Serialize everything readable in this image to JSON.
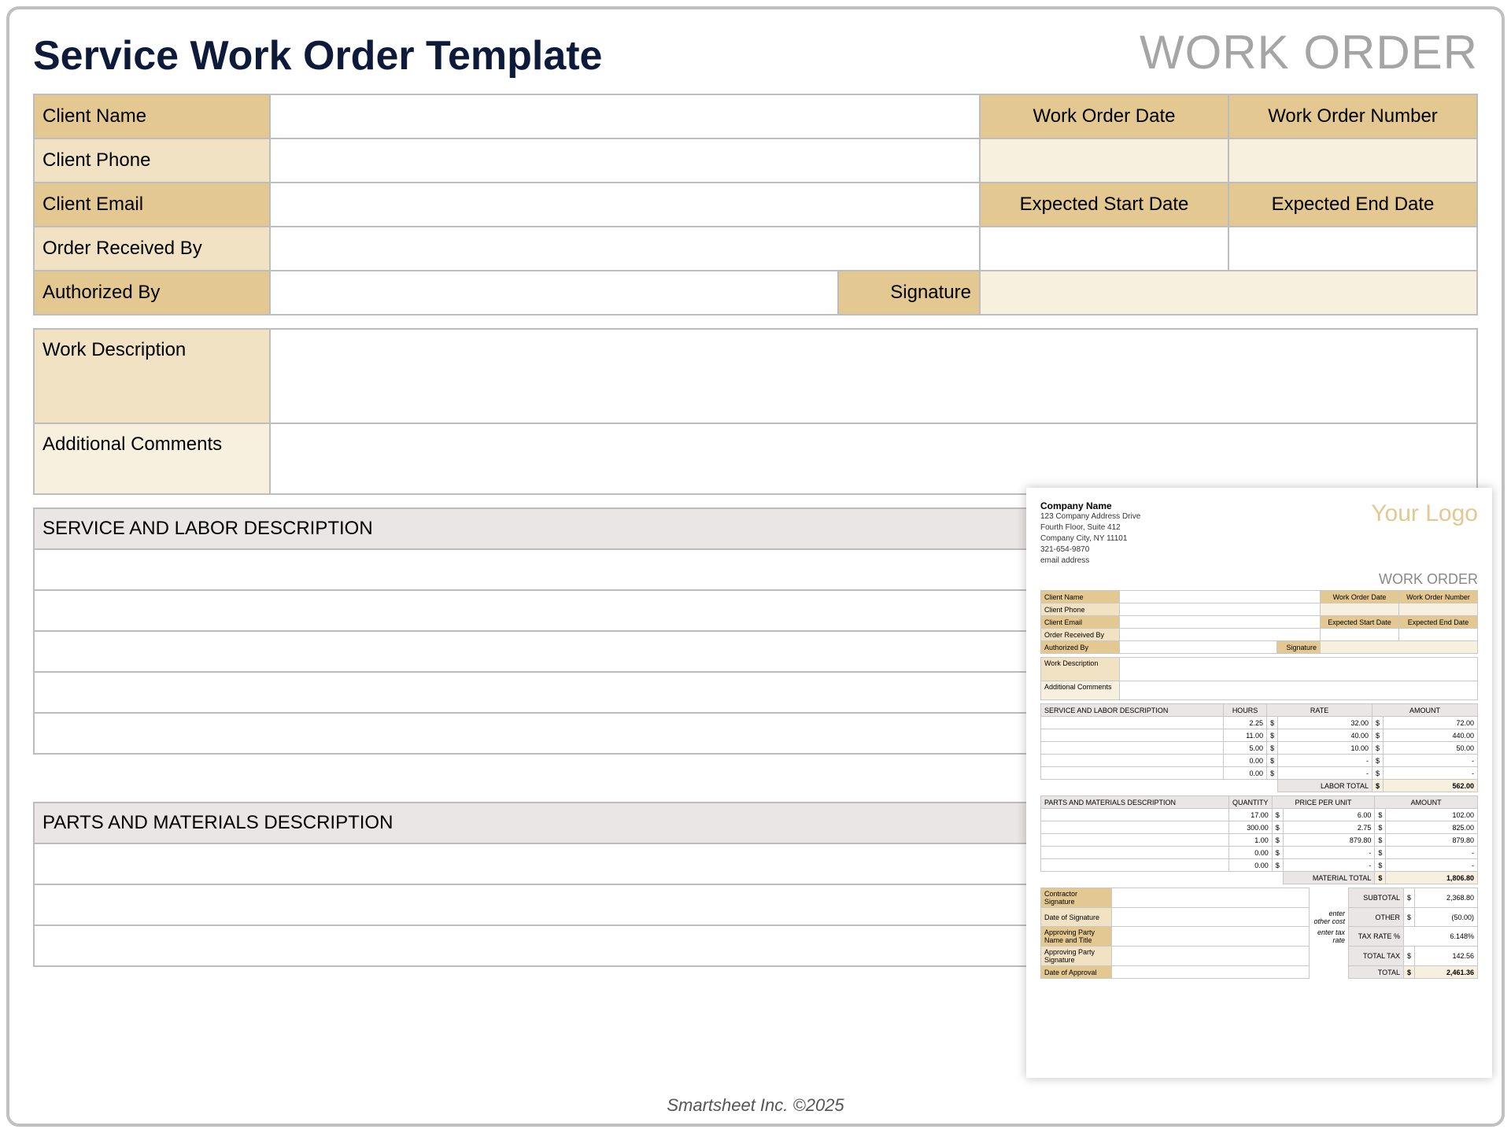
{
  "title": "Service Work Order Template",
  "workorder_label": "WORK ORDER",
  "labels": {
    "client_name": "Client Name",
    "client_phone": "Client Phone",
    "client_email": "Client Email",
    "order_received_by": "Order Received By",
    "authorized_by": "Authorized By",
    "signature": "Signature",
    "work_order_date": "Work Order Date",
    "work_order_number": "Work Order Number",
    "expected_start": "Expected Start Date",
    "expected_end": "Expected End Date",
    "work_description": "Work Description",
    "additional_comments": "Additional Comments",
    "service_labor": "SERVICE AND LABOR DESCRIPTION",
    "hours": "HOURS",
    "parts_materials": "PARTS AND MATERIALS DESCRIPTION",
    "quantity": "QUANTITY"
  },
  "service_rows": [
    {
      "hours": "2.25",
      "d": "$"
    },
    {
      "hours": "11.00",
      "d": "$"
    },
    {
      "hours": "5.00",
      "d": "$"
    },
    {
      "hours": "0.00",
      "d": "$"
    },
    {
      "hours": "0.00",
      "d": "$"
    }
  ],
  "parts_rows": [
    {
      "qty": "17.00",
      "d": "$"
    },
    {
      "qty": "300.00",
      "d": "$"
    },
    {
      "qty": "1.00",
      "d": "$"
    }
  ],
  "footer": "Smartsheet Inc. ©2025",
  "thumb": {
    "company_name": "Company Name",
    "addr1": "123 Company Address Drive",
    "addr2": "Fourth Floor, Suite 412",
    "addr3": "Company City, NY  11101",
    "phone": "321-654-9870",
    "email": "email address",
    "logo": "Your Logo",
    "wo": "WORK ORDER",
    "labels": {
      "client_name": "Client Name",
      "client_phone": "Client Phone",
      "client_email": "Client Email",
      "order_received_by": "Order Received By",
      "authorized_by": "Authorized By",
      "signature": "Signature",
      "wo_date": "Work Order Date",
      "wo_num": "Work Order Number",
      "exp_start": "Expected Start Date",
      "exp_end": "Expected End Date",
      "work_desc": "Work Description",
      "add_comments": "Additional Comments",
      "svc": "SERVICE AND LABOR DESCRIPTION",
      "hours": "HOURS",
      "rate": "RATE",
      "amount": "AMOUNT",
      "labor_total": "LABOR TOTAL",
      "parts": "PARTS AND MATERIALS DESCRIPTION",
      "qty": "QUANTITY",
      "ppu": "PRICE PER UNIT",
      "mat_total": "MATERIAL TOTAL",
      "subtotal": "SUBTOTAL",
      "other": "OTHER",
      "taxrate": "TAX RATE %",
      "totaltax": "TOTAL TAX",
      "total": "TOTAL",
      "contractor_sig": "Contractor Signature",
      "date_sig": "Date of Signature",
      "appr_name": "Approving Party Name and Title",
      "appr_sig": "Approving Party Signature",
      "date_appr": "Date of Approval",
      "enter_other": "enter other cost",
      "enter_tax": "enter tax rate"
    },
    "svc_rows": [
      {
        "hours": "2.25",
        "rate": "32.00",
        "amount": "72.00"
      },
      {
        "hours": "11.00",
        "rate": "40.00",
        "amount": "440.00"
      },
      {
        "hours": "5.00",
        "rate": "10.00",
        "amount": "50.00"
      },
      {
        "hours": "0.00",
        "rate": "-",
        "amount": "-"
      },
      {
        "hours": "0.00",
        "rate": "-",
        "amount": "-"
      }
    ],
    "labor_total": "562.00",
    "parts_rows": [
      {
        "qty": "17.00",
        "ppu": "6.00",
        "amount": "102.00"
      },
      {
        "qty": "300.00",
        "ppu": "2.75",
        "amount": "825.00"
      },
      {
        "qty": "1.00",
        "ppu": "879.80",
        "amount": "879.80"
      },
      {
        "qty": "0.00",
        "ppu": "-",
        "amount": "-"
      },
      {
        "qty": "0.00",
        "ppu": "-",
        "amount": "-"
      }
    ],
    "material_total": "1,806.80",
    "subtotal": "2,368.80",
    "other": "(50.00)",
    "taxrate": "6.148%",
    "totaltax": "142.56",
    "total": "2,461.36",
    "d": "$"
  }
}
